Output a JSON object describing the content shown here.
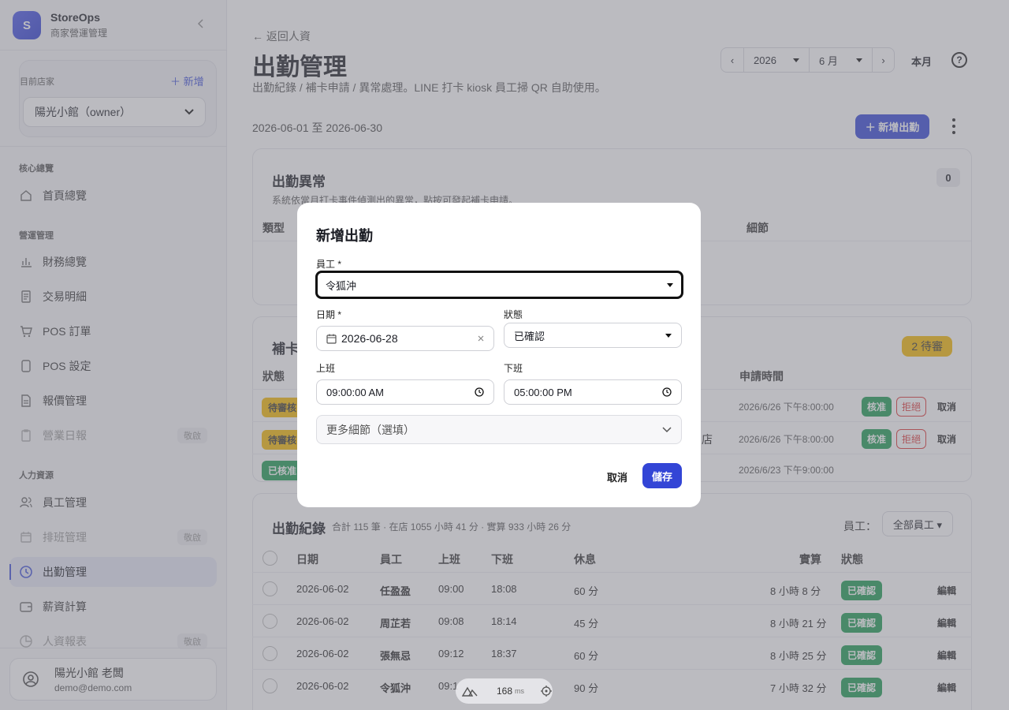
{
  "sidebar": {
    "brand_initial": "S",
    "brand_name": "StoreOps",
    "brand_sub": "商家營運管理",
    "current_store_label": "目前店家",
    "new_store_label": "＋ 新增",
    "store_value": "陽光小館（owner）",
    "sections": {
      "core": "核心總覽",
      "ops": "營運管理",
      "hr": "人力資源"
    },
    "items": {
      "home": "首頁總覽",
      "finance": "財務總覽",
      "transactions": "交易明細",
      "pos_orders": "POS 訂單",
      "pos_settings": "POS 設定",
      "quotes": "報價管理",
      "daily_report": "營業日報",
      "staff": "員工管理",
      "schedule": "排班管理",
      "attendance": "出勤管理",
      "payroll": "薪資計算",
      "hr_report": "人資報表"
    },
    "tag_label": "敬啟",
    "user_name": "陽光小館 老闆",
    "user_email": "demo@demo.com"
  },
  "header": {
    "back": "← 返回人資",
    "title": "出勤管理",
    "subtitle": "出勤紀錄 / 補卡申請 / 異常處理。LINE 打卡 kiosk 員工掃 QR 自助使用。",
    "prev": "‹",
    "year": "2026",
    "month": "6 月",
    "next": "›",
    "this_month": "本月",
    "help": "?",
    "range": "2026-06-01 至 2026-06-30",
    "add_button": "＋ 新增出勤"
  },
  "anomaly": {
    "title": "出勤異常",
    "count": "0",
    "desc": "系統依當月打卡事件偵測出的異常，點按可發起補卡申請。",
    "col_type": "類型",
    "col_detail": "細節"
  },
  "makeup": {
    "title": "補卡",
    "pending": "2 待審",
    "col_status": "狀態",
    "col_time": "申請時間",
    "rows": [
      {
        "status": "待審核",
        "time": "2026/6/26 下午8:00:00",
        "approve": "核准",
        "reject": "拒絕",
        "cancel": "取消",
        "extra": ""
      },
      {
        "status": "待審核",
        "time": "2026/6/26 下午8:00:00",
        "approve": "核准",
        "reject": "拒絕",
        "cancel": "取消",
        "extra": "店"
      },
      {
        "status": "已核准",
        "time": "2026/6/23 下午9:00:00",
        "approve": "",
        "reject": "",
        "cancel": "",
        "extra": ""
      }
    ]
  },
  "records": {
    "title": "出勤紀錄",
    "summary": "合計 115 筆 · 在店 1055 小時 41 分 · 實算 933 小時 26 分",
    "filter_label": "員工：",
    "filter_value": "全部員工 ▾",
    "columns": [
      "日期",
      "員工",
      "上班",
      "下班",
      "休息",
      "實算",
      "狀態"
    ],
    "rows": [
      {
        "date": "2026-06-02",
        "name": "任盈盈",
        "in": "09:00",
        "out": "18:08",
        "rest": "60 分",
        "net": "8 小時 8 分",
        "status": "已確認",
        "edit": "編輯"
      },
      {
        "date": "2026-06-02",
        "name": "周芷若",
        "in": "09:08",
        "out": "18:14",
        "rest": "45 分",
        "net": "8 小時 21 分",
        "status": "已確認",
        "edit": "編輯"
      },
      {
        "date": "2026-06-02",
        "name": "張無忌",
        "in": "09:12",
        "out": "18:37",
        "rest": "60 分",
        "net": "8 小時 25 分",
        "status": "已確認",
        "edit": "編輯"
      },
      {
        "date": "2026-06-02",
        "name": "令狐沖",
        "in": "09:1",
        "out": "",
        "rest": "90 分",
        "net": "7 小時 32 分",
        "status": "已確認",
        "edit": "編輯"
      }
    ]
  },
  "modal": {
    "title": "新增出勤",
    "employee_label": "員工 *",
    "employee_value": "令狐沖",
    "date_label": "日期 *",
    "date_value": "2026-06-28",
    "status_label": "狀態",
    "status_value": "已確認",
    "in_label": "上班",
    "in_value": "09:00:00 AM",
    "out_label": "下班",
    "out_value": "05:00:00 PM",
    "more_label": "更多細節（選填）",
    "cancel": "取消",
    "save": "儲存"
  },
  "devbar": {
    "ms_value": "168",
    "ms_unit": "ms"
  },
  "colors": {
    "accent": "#3345d6",
    "ok": "#1a9b50",
    "pending": "#f5b800",
    "reject": "#dd3333"
  }
}
